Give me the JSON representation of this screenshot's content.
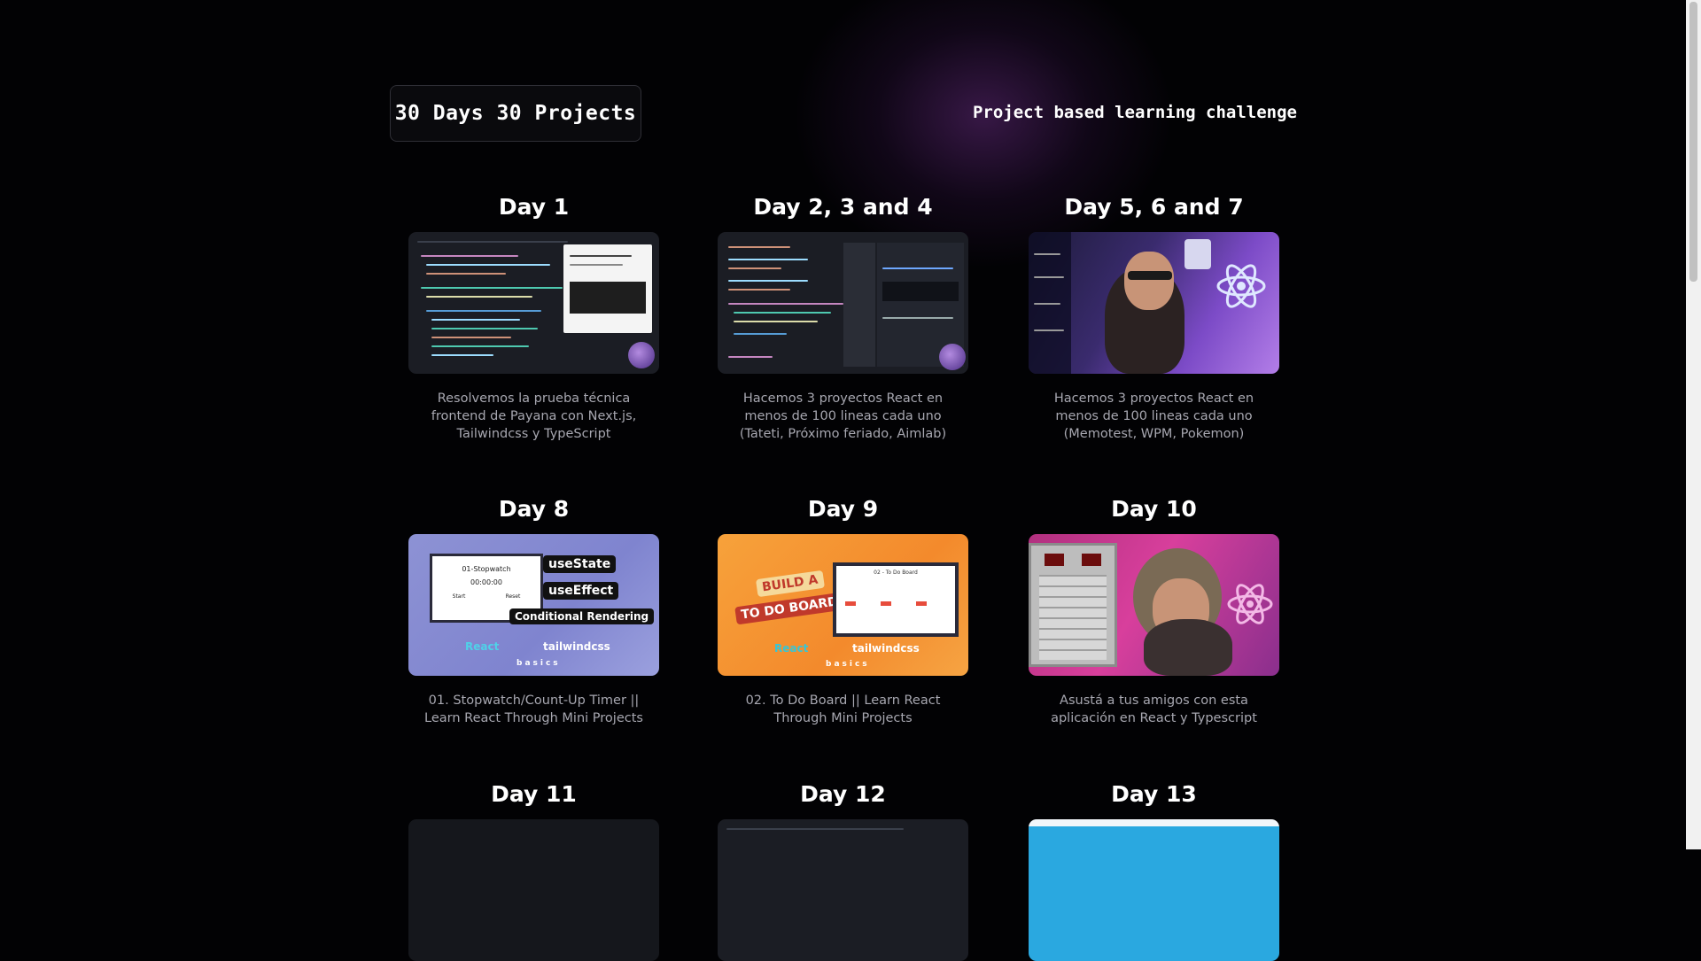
{
  "header": {
    "brand": "30 Days 30 Projects",
    "tagline": "Project based learning challenge"
  },
  "cards": [
    {
      "title": "Day 1",
      "description": "Resolvemos la prueba técnica frontend de Payana con Next.js, Tailwindcss y TypeScript"
    },
    {
      "title": "Day 2, 3 and 4",
      "description": "Hacemos 3 proyectos React en menos de 100 lineas cada uno (Tateti, Próximo feriado, Aimlab)"
    },
    {
      "title": "Day 5, 6 and 7",
      "description": "Hacemos 3 proyectos React en menos de 100 lineas cada uno (Memotest, WPM, Pokemon)"
    },
    {
      "title": "Day 8",
      "description": "01. Stopwatch/Count-Up Timer || Learn React Through Mini Projects"
    },
    {
      "title": "Day 9",
      "description": "02. To Do Board || Learn React Through Mini Projects"
    },
    {
      "title": "Day 10",
      "description": "Asustá a tus amigos con esta aplicación en React y Typescript"
    },
    {
      "title": "Day 11",
      "description": ""
    },
    {
      "title": "Day 12",
      "description": ""
    },
    {
      "title": "Day 13",
      "description": ""
    }
  ],
  "thumbs": {
    "day8": {
      "box_title": "01-Stopwatch",
      "time": "00:00:00",
      "start": "Start",
      "reset": "Reset",
      "pill1": "useState",
      "pill2": "useEffect",
      "pill3": "Conditional Rendering",
      "react": "React",
      "tailwind": "tailwindcss",
      "basics": "basics"
    },
    "day9": {
      "banner1": "BUILD A",
      "banner2": "TO DO BOARD",
      "board_title": "02 - To Do Board",
      "react": "React",
      "tailwind": "tailwindcss",
      "basics": "basics"
    }
  }
}
